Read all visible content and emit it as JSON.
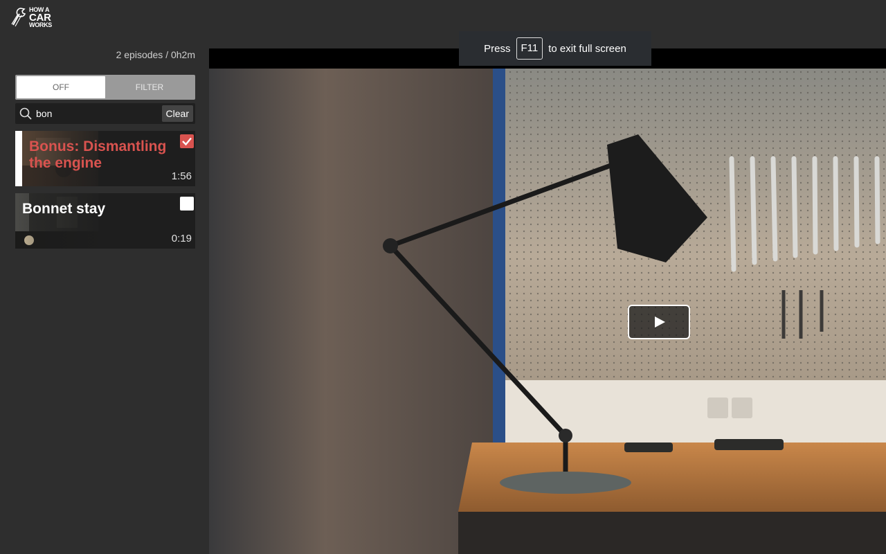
{
  "logo": {
    "line1": "HOW A",
    "line2": "CAR",
    "line3": "WORKS"
  },
  "sidebar": {
    "episode_count": "2 episodes / 0h2m",
    "toggle": {
      "off_label": "OFF",
      "filter_label": "FILTER"
    },
    "search": {
      "value": "bon",
      "clear_label": "Clear"
    },
    "episodes": [
      {
        "title": "Bonus: Dismantling the engine",
        "duration": "1:56",
        "checked": true,
        "active": true
      },
      {
        "title": "Bonnet stay",
        "duration": "0:19",
        "checked": false,
        "active": false
      }
    ]
  },
  "fullscreen_notice": {
    "prefix": "Press",
    "key": "F11",
    "suffix": "to exit full screen"
  },
  "colors": {
    "accent": "#d9534f",
    "background": "#2e2e2e"
  }
}
